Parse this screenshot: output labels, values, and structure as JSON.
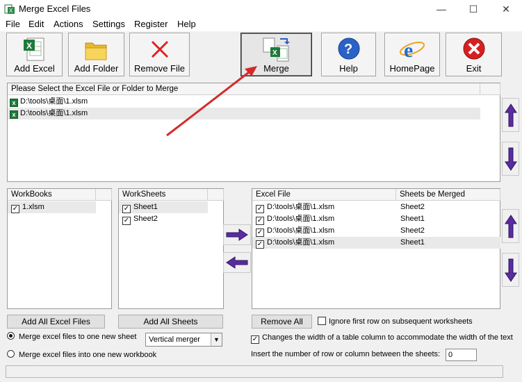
{
  "window": {
    "title": "Merge Excel Files"
  },
  "menu": [
    "File",
    "Edit",
    "Actions",
    "Settings",
    "Register",
    "Help"
  ],
  "toolbar": {
    "add_excel": "Add Excel",
    "add_folder": "Add Folder",
    "remove_file": "Remove File",
    "merge": "Merge",
    "help": "Help",
    "homepage": "HomePage",
    "exit": "Exit"
  },
  "file_list": {
    "header": "Please Select the Excel File or Folder to Merge",
    "items": [
      "D:\\tools\\桌面\\1.xlsm",
      "D:\\tools\\桌面\\1.xlsm"
    ]
  },
  "workbooks": {
    "header": "WorkBooks",
    "items": [
      "1.xlsm"
    ]
  },
  "worksheets": {
    "header": "WorkSheets",
    "items": [
      "Sheet1",
      "Sheet2"
    ]
  },
  "merge_table": {
    "col_file": "Excel File",
    "col_sheets": "Sheets be Merged",
    "rows": [
      {
        "file": "D:\\tools\\桌面\\1.xlsm",
        "sheet": "Sheet2"
      },
      {
        "file": "D:\\tools\\桌面\\1.xlsm",
        "sheet": "Sheet1"
      },
      {
        "file": "D:\\tools\\桌面\\1.xlsm",
        "sheet": "Sheet2"
      },
      {
        "file": "D:\\tools\\桌面\\1.xlsm",
        "sheet": "Sheet1"
      }
    ]
  },
  "bottom": {
    "add_all_excel": "Add All Excel Files",
    "add_all_sheets": "Add All Sheets",
    "remove_all": "Remove All",
    "ignore_first_row": "Ignore first row on subsequent worksheets",
    "change_width": "Changes the width of a table column to accommodate the width of the text",
    "insert_number": "Insert the number of row or column between the sheets:",
    "insert_value": "0",
    "radio_one_sheet": "Merge excel files to one new sheet",
    "radio_one_workbook": "Merge excel files into one new workbook",
    "merger_mode": "Vertical merger"
  },
  "colors": {
    "arrow_red": "#d42a2a",
    "move_arrow": "#5a2ca0"
  }
}
